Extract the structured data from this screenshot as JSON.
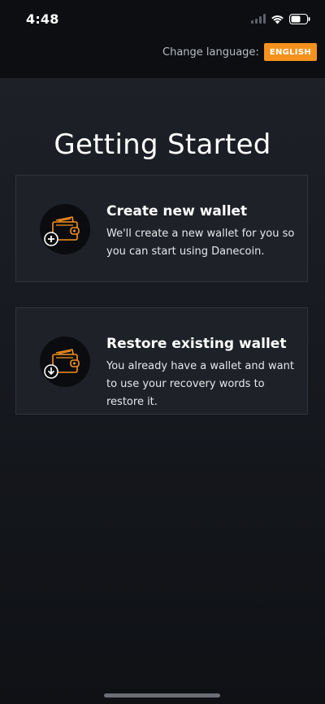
{
  "status_bar": {
    "time": "4:48",
    "icons": [
      "cellular-signal-icon",
      "wifi-icon",
      "battery-icon"
    ]
  },
  "language": {
    "label": "Change language:",
    "value": "ENGLISH"
  },
  "title": "Getting Started",
  "options": [
    {
      "title": "Create new wallet",
      "description": "We'll create a new wallet for you so you can start using Danecoin.",
      "icon": "wallet-add-icon"
    },
    {
      "title": "Restore existing wallet",
      "description": "You already have a wallet and want to use your recovery words to restore it.",
      "icon": "wallet-restore-icon"
    }
  ],
  "colors": {
    "accent": "#f5921e",
    "background": "#111318",
    "card": "#1e2128"
  }
}
